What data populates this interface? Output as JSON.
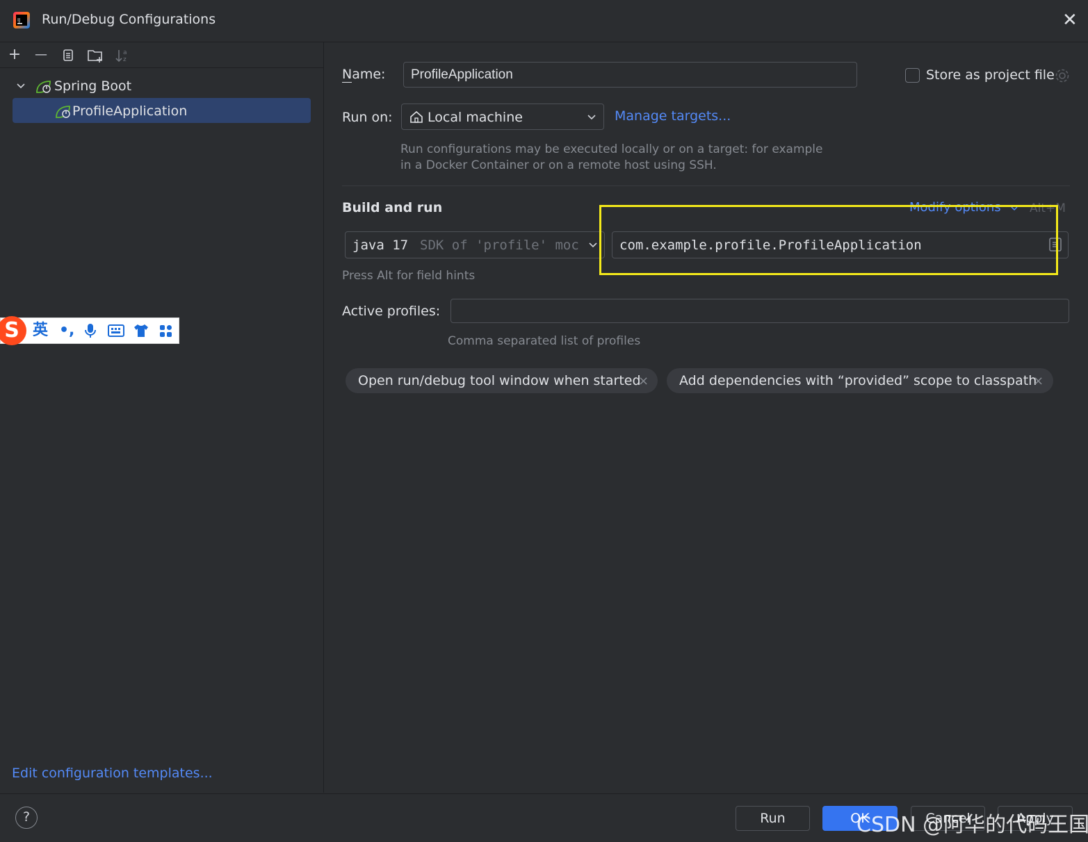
{
  "window": {
    "title": "Run/Debug Configurations",
    "close_symbol": "✕",
    "logo_icon": "intellij-idea-logo"
  },
  "toolbar": {
    "add_symbol": "+",
    "remove_symbol": "—",
    "icons": [
      "plus-icon",
      "minus-icon",
      "copy-icon",
      "new-folder-icon",
      "sort-icon"
    ]
  },
  "tree": {
    "group_label": "Spring Boot",
    "group_icon": "spring-boot-icon",
    "item_label": "ProfileApplication",
    "item_icon": "spring-boot-app-icon"
  },
  "sidebar_footer": {
    "templates_link": "Edit configuration templates..."
  },
  "form": {
    "name_label": "Name:",
    "name_value": "ProfileApplication",
    "store_label": "Store as project file",
    "store_checked": false,
    "run_on_label": "Run on:",
    "run_on_value": "Local machine",
    "manage_targets": "Manage targets...",
    "run_on_hint_line1": "Run configurations may be executed locally or on a target: for example",
    "run_on_hint_line2": "in a Docker Container or on a remote host using SSH.",
    "section_title": "Build and run",
    "modify_options": "Modify options",
    "modify_shortcut": "Alt+M",
    "jdk_version": "java 17",
    "jdk_detail": "SDK of 'profile' moc",
    "main_class": "com.example.profile.ProfileApplication",
    "field_hint": "Press Alt for field hints",
    "profiles_label": "Active profiles:",
    "profiles_value": "",
    "profiles_hint": "Comma separated list of profiles",
    "chips": [
      "Open run/debug tool window when started",
      "Add dependencies with “provided” scope to classpath"
    ],
    "chip_close_symbol": "×"
  },
  "footer": {
    "help_symbol": "?",
    "run_label": "Run",
    "ok_label": "OK",
    "cancel_label": "Cancel",
    "apply_label": "Apply"
  },
  "ime_toolbar": {
    "logo_letter": "S",
    "lang": "英",
    "punct": "•,",
    "icons": [
      "sogou-logo-icon",
      "punctuation-icon",
      "microphone-icon",
      "keyboard-icon",
      "skin-shirt-icon",
      "grid-apps-icon"
    ]
  },
  "watermark": "CSDN @阿华的代码王国",
  "colors": {
    "bg": "#2b2d30",
    "accent": "#3574f0",
    "link": "#548af7",
    "selection": "#2e436e",
    "highlight": "#f5ea1a"
  }
}
